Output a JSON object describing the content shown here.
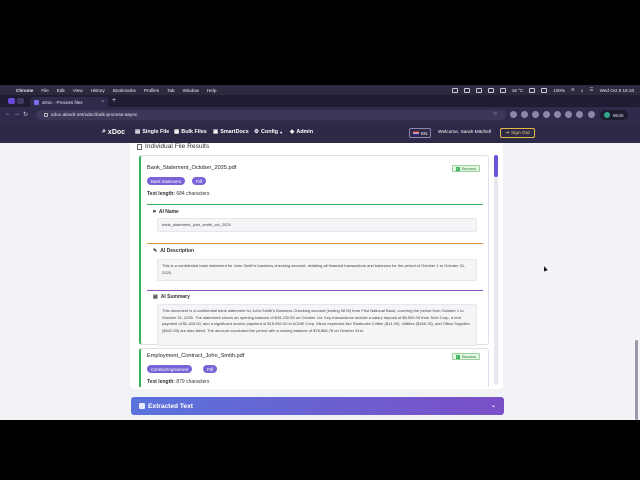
{
  "macos_menu": {
    "items": [
      "Chrome",
      "File",
      "Edit",
      "View",
      "History",
      "Bookmarks",
      "Profiles",
      "Tab",
      "Window",
      "Help"
    ],
    "temperature": "18 °C",
    "battery": "100%",
    "datetime": "Wed Oct 8  19:10"
  },
  "browser": {
    "tab_title": "xDoc - Process files",
    "url": "xdoc.alexdr.net/xdoc/bulk-process-async",
    "profile_label": "Work"
  },
  "app": {
    "logo": "xDoc",
    "nav": [
      {
        "label": "Single File",
        "icon": "file-icon"
      },
      {
        "label": "Bulk Files",
        "icon": "files-icon"
      },
      {
        "label": "SmartDocs",
        "icon": "docs-icon"
      },
      {
        "label": "Config",
        "icon": "gear-icon"
      },
      {
        "label": "Admin",
        "icon": "shield-icon"
      }
    ],
    "language": "EN",
    "welcome": "Welcome, Sarah Mitchell",
    "sign_out": "Sign Out"
  },
  "results": {
    "title": "Individual File Results",
    "files": [
      {
        "name": "Bank_Statement_October_2025.pdf",
        "status": "Success",
        "tags": [
          "Bank Statement",
          "Pdf"
        ],
        "text_length_label": "Text length:",
        "text_length_value": "684 characters",
        "ai_name_label": "AI Name",
        "ai_name": "bank_statement_john_smith_oct_2025",
        "ai_description_label": "AI Description",
        "ai_description": "This is a confidential bank statement for John Smith's business checking account, detailing all financial transactions and balances for the period of October 1 to October 31, 2025.",
        "ai_summary_label": "AI Summary",
        "ai_summary": "This document is a confidential bank statement for John Smith's Business Checking account (ending 5678) from First National Bank, covering the period from October 1 to October 31, 2025. The statement shows an opening balance of $45,230.50 on October 1st. Key transactions include a salary deposit of $8,500.00 from Tech Corp, a rent payment of $2,400.00, and a significant invoice payment of $18,950.00 to ACME Corp. Minor expenses like Starbucks Coffee ($14.99), Utilities ($156.78), and Office Supplies ($342.55) are also listed. The account concluded the period with a closing balance of $78,866.78 on October 31st."
      },
      {
        "name": "Employment_Contract_John_Smith.pdf",
        "status": "Success",
        "tags": [
          "Contract/Agreement",
          "Pdf"
        ],
        "text_length_label": "Text length:",
        "text_length_value": "879 characters"
      }
    ]
  },
  "extracted_text": {
    "label": "Extracted Text"
  },
  "colors": {
    "header_bg": "#2d2a48",
    "accent_purple": "#7a63d6",
    "success_green": "#38b25a",
    "sign_out_gold": "#e6b84a"
  }
}
